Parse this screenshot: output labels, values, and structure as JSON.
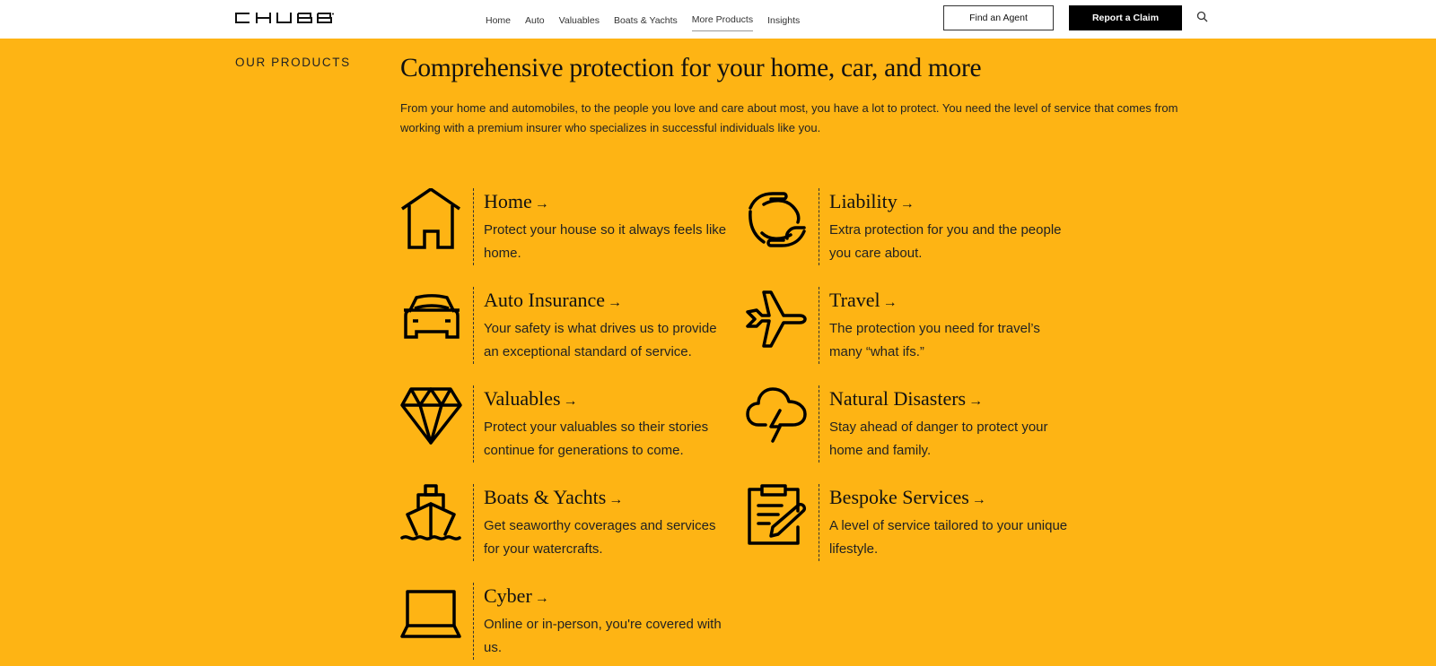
{
  "header": {
    "logo": "CHUBB",
    "nav": [
      {
        "label": "Home",
        "active": false
      },
      {
        "label": "Auto",
        "active": false
      },
      {
        "label": "Valuables",
        "active": false
      },
      {
        "label": "Boats & Yachts",
        "active": false
      },
      {
        "label": "More Products",
        "active": true
      },
      {
        "label": "Insights",
        "active": false
      }
    ],
    "find_agent_label": "Find an Agent",
    "report_claim_label": "Report a Claim",
    "search_icon": "search-icon"
  },
  "section": {
    "eyebrow": "OUR PRODUCTS",
    "title": "Comprehensive protection for your home, car, and more",
    "intro": "From your home and automobiles, to the people you love and care about most, you have a lot to protect. You need the level of service that comes from working with a premium insurer who specializes in successful individuals like you."
  },
  "products": [
    {
      "title": "Home",
      "arrow": "→",
      "icon": "house-icon",
      "description": "Protect your house so it always feels like home."
    },
    {
      "title": "Liability",
      "arrow": "→",
      "icon": "hands-icon",
      "description": "Extra protection for you and the people you care about."
    },
    {
      "title": "Auto Insurance",
      "arrow": "→",
      "icon": "car-icon",
      "description": "Your safety is what drives us to provide an exceptional standard of service."
    },
    {
      "title": "Travel",
      "arrow": "→",
      "icon": "airplane-icon",
      "description": "The protection you need for travel’s many “what ifs.”"
    },
    {
      "title": "Valuables",
      "arrow": "→",
      "icon": "diamond-icon",
      "description": "Protect your valuables so their stories continue for generations to come."
    },
    {
      "title": "Natural Disasters",
      "arrow": "→",
      "icon": "storm-cloud-icon",
      "description": "Stay ahead of danger to protect your home and family."
    },
    {
      "title": "Boats & Yachts",
      "arrow": "→",
      "icon": "ship-icon",
      "description": "Get seaworthy coverages and services for your watercrafts."
    },
    {
      "title": "Bespoke Services",
      "arrow": "→",
      "icon": "clipboard-pen-icon",
      "description": "A level of service tailored to your unique lifestyle."
    },
    {
      "title": "Cyber",
      "arrow": "→",
      "icon": "laptop-icon",
      "description": "Online or in-person, you're covered with us."
    }
  ],
  "colors": {
    "background": "#FEB414",
    "header": "#FFFFFF",
    "primary_button": "#000000"
  }
}
